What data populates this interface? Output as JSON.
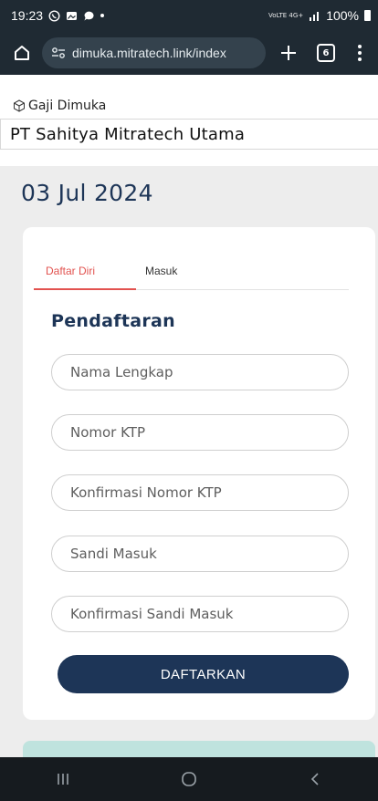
{
  "status_bar": {
    "time": "19:23",
    "network_top": "VoLTE 4G+",
    "battery": "100%"
  },
  "browser": {
    "url": "dimuka.mitratech.link/index",
    "tab_count": "6"
  },
  "page": {
    "app_name": "Gaji Dimuka",
    "company": "PT Sahitya Mitratech Utama",
    "date": "03 Jul 2024"
  },
  "form": {
    "tabs": [
      "Daftar Diri",
      "Masuk"
    ],
    "title": "Pendaftaran",
    "fields": {
      "full_name": "Nama Lengkap",
      "ktp": "Nomor KTP",
      "ktp_confirm": "Konfirmasi Nomor KTP",
      "password": "Sandi Masuk",
      "password_confirm": "Konfirmasi Sandi Masuk"
    },
    "submit_label": "DAFTARKAN"
  },
  "colors": {
    "primary": "#1d3557",
    "tab_accent": "#e2524f",
    "chrome_bg": "#1f2a33",
    "footer_card": "#bfe3de"
  }
}
